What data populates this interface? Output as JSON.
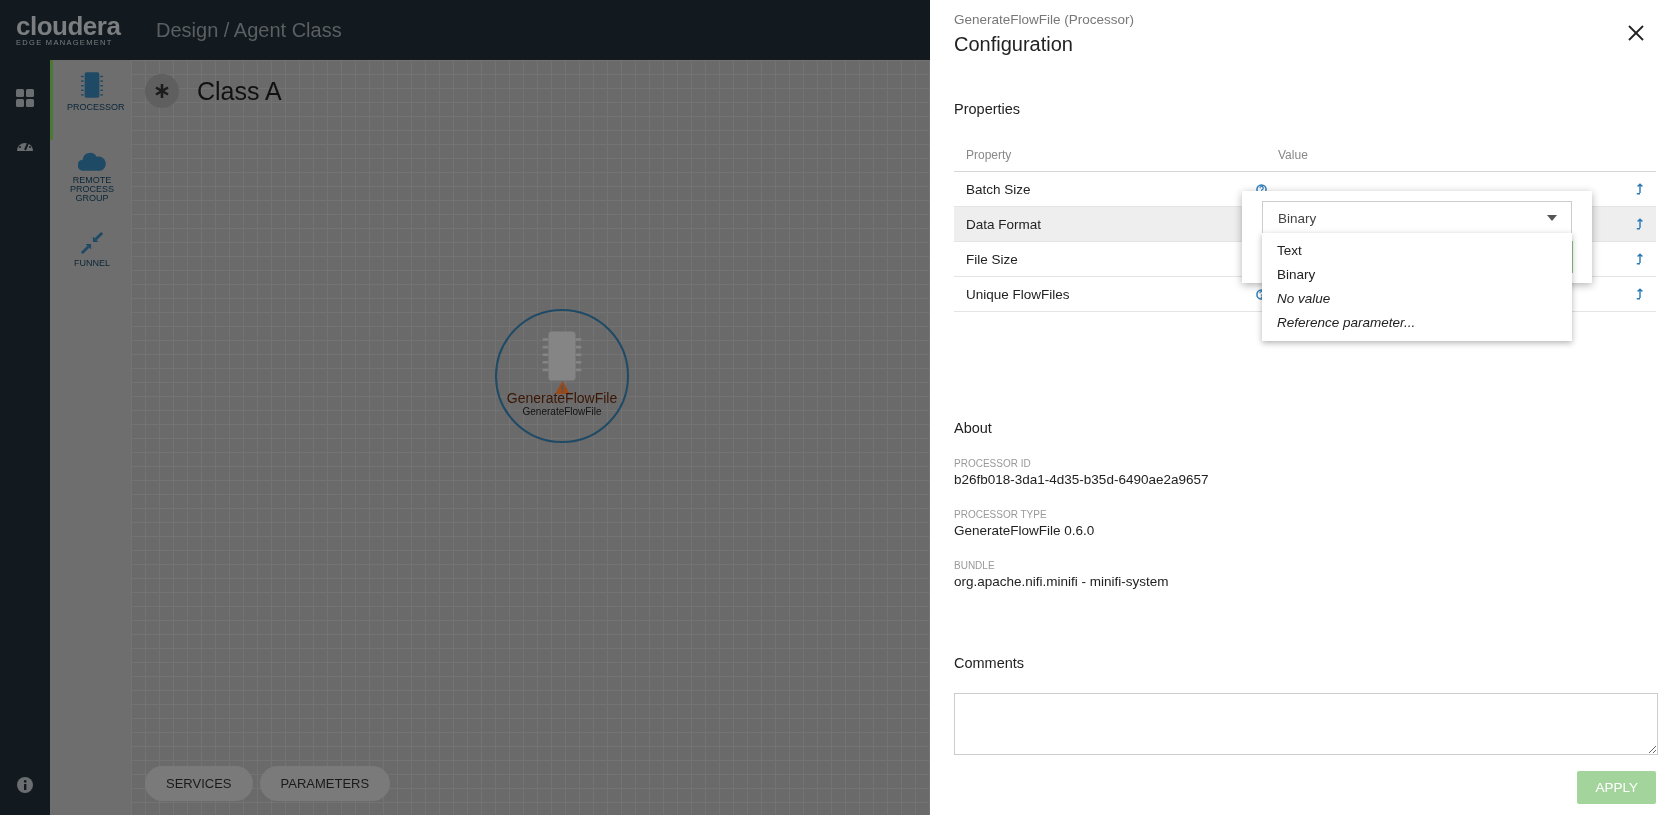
{
  "header": {
    "logo_name": "cloudera",
    "logo_sub": "EDGE MANAGEMENT",
    "breadcrumb": "Design / Agent Class"
  },
  "rail": [
    {
      "kind": "grid",
      "selected": false
    },
    {
      "kind": "gauge",
      "selected": false
    }
  ],
  "palette": [
    {
      "label": "PROCESSOR",
      "kind": "processor",
      "selected": true
    },
    {
      "label": "REMOTE PROCESS GROUP",
      "kind": "cloud",
      "selected": false
    },
    {
      "label": "FUNNEL",
      "kind": "funnel",
      "selected": false
    }
  ],
  "canvas": {
    "title": "Class A",
    "node": {
      "title": "GenerateFlowFile",
      "subtitle": "GenerateFlowFile",
      "warning": true
    },
    "buttons": [
      "SERVICES",
      "PARAMETERS"
    ]
  },
  "panel": {
    "subtitle": "GenerateFlowFile (Processor)",
    "title": "Configuration",
    "properties_heading": "Properties",
    "columns": [
      "Property",
      "Value"
    ],
    "rows": [
      {
        "name": "Batch Size",
        "help": true,
        "selected": false
      },
      {
        "name": "Data Format",
        "selected": true
      },
      {
        "name": "File Size",
        "selected": false
      },
      {
        "name": "Unique FlowFiles",
        "help": true,
        "selected": false
      }
    ],
    "editor": {
      "value": "Binary",
      "options": [
        {
          "label": "Text",
          "kind": "value"
        },
        {
          "label": "Binary",
          "kind": "value"
        },
        {
          "label": "No value",
          "kind": "special"
        },
        {
          "label": "Reference parameter...",
          "kind": "special"
        }
      ]
    },
    "about_heading": "About",
    "about": [
      {
        "label": "PROCESSOR ID",
        "value": "b26fb018-3da1-4d35-b35d-6490ae2a9657"
      },
      {
        "label": "PROCESSOR TYPE",
        "value": "GenerateFlowFile 0.6.0"
      },
      {
        "label": "BUNDLE",
        "value": "org.apache.nifi.minifi - minifi-system"
      }
    ],
    "comments_heading": "Comments",
    "apply": {
      "label": "APPLY",
      "disabled": true
    }
  }
}
